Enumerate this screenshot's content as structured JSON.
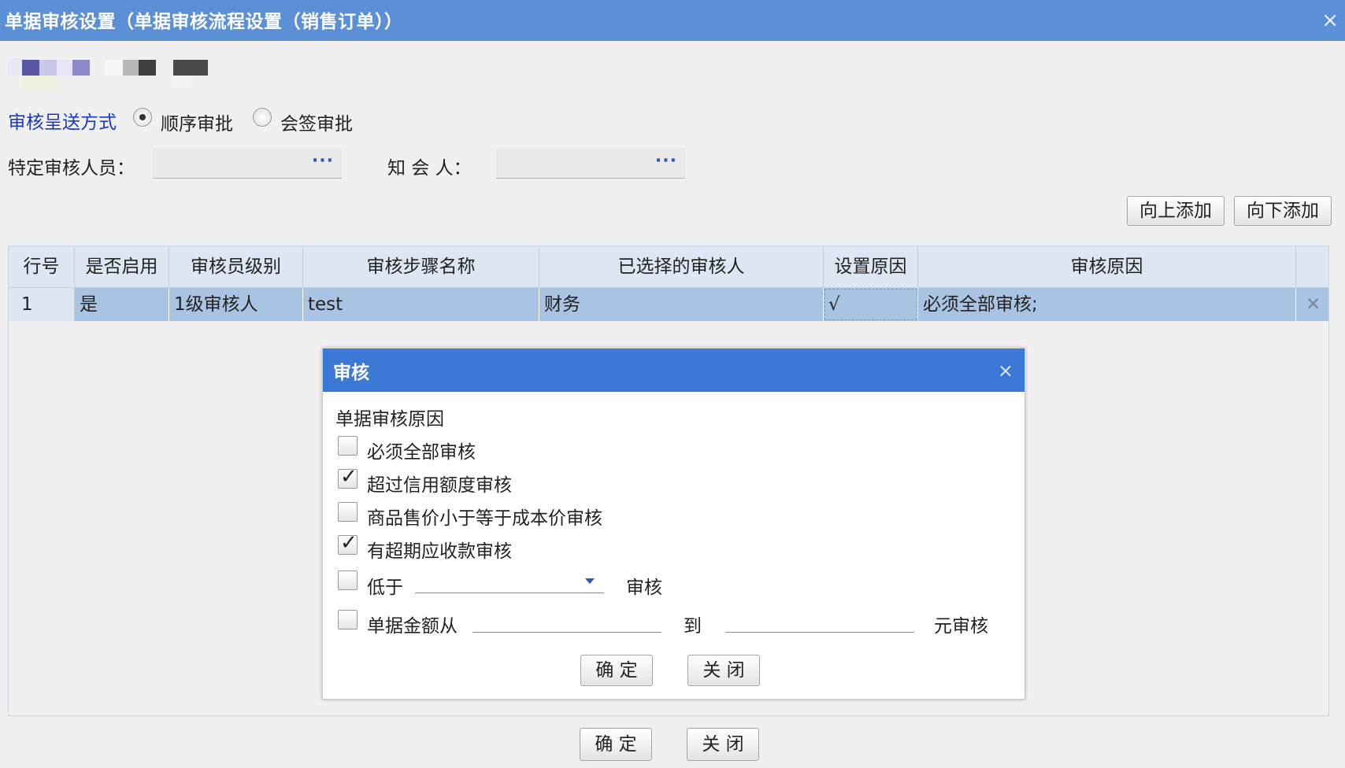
{
  "window": {
    "title": "单据审核设置（单据审核流程设置（销售订单））",
    "close_glyph": "×"
  },
  "approval": {
    "mode_label": "审核呈送方式",
    "options": [
      "顺序审批",
      "会签审批"
    ],
    "selected_option": "顺序审批"
  },
  "fields": {
    "specific_reviewer_label": "特定审核人员：",
    "cc_label": "知 会 人：",
    "picker_dots": "···"
  },
  "toolbar": {
    "add_above": "向上添加",
    "add_below": "向下添加"
  },
  "table": {
    "columns": [
      "行号",
      "是否启用",
      "审核员级别",
      "审核步骤名称",
      "已选择的审核人",
      "设置原因",
      "审核原因"
    ],
    "rows": [
      {
        "row_no": "1",
        "enabled": "是",
        "level": "1级审核人",
        "step_name": "test",
        "reviewers": "财务",
        "set_reason": "√",
        "reason": "必须全部审核;",
        "delete_glyph": "✕"
      }
    ]
  },
  "dialog": {
    "title": "审核",
    "close_glyph": "×",
    "section_label": "单据审核原因",
    "options": [
      {
        "label": "必须全部审核",
        "checked": false
      },
      {
        "label": "超过信用额度审核",
        "checked": true
      },
      {
        "label": "商品售价小于等于成本价审核",
        "checked": false
      },
      {
        "label": "有超期应收款审核",
        "checked": true
      }
    ],
    "below_label": "低于",
    "below_select_value": "",
    "below_suffix": "审核",
    "amount_label": "单据金额从",
    "amount_from": "",
    "amount_to_label": "到",
    "amount_to": "",
    "amount_suffix": "元审核",
    "confirm": "确 定",
    "close": "关 闭",
    "check_glyph": "✓"
  },
  "footer": {
    "confirm": "确 定",
    "close": "关 闭"
  },
  "colors": {
    "titlebar": "#5b8fd6",
    "dialog_header": "#3c78d6",
    "selected_row": "#a9c4e2",
    "link_label": "#1c38c8"
  }
}
